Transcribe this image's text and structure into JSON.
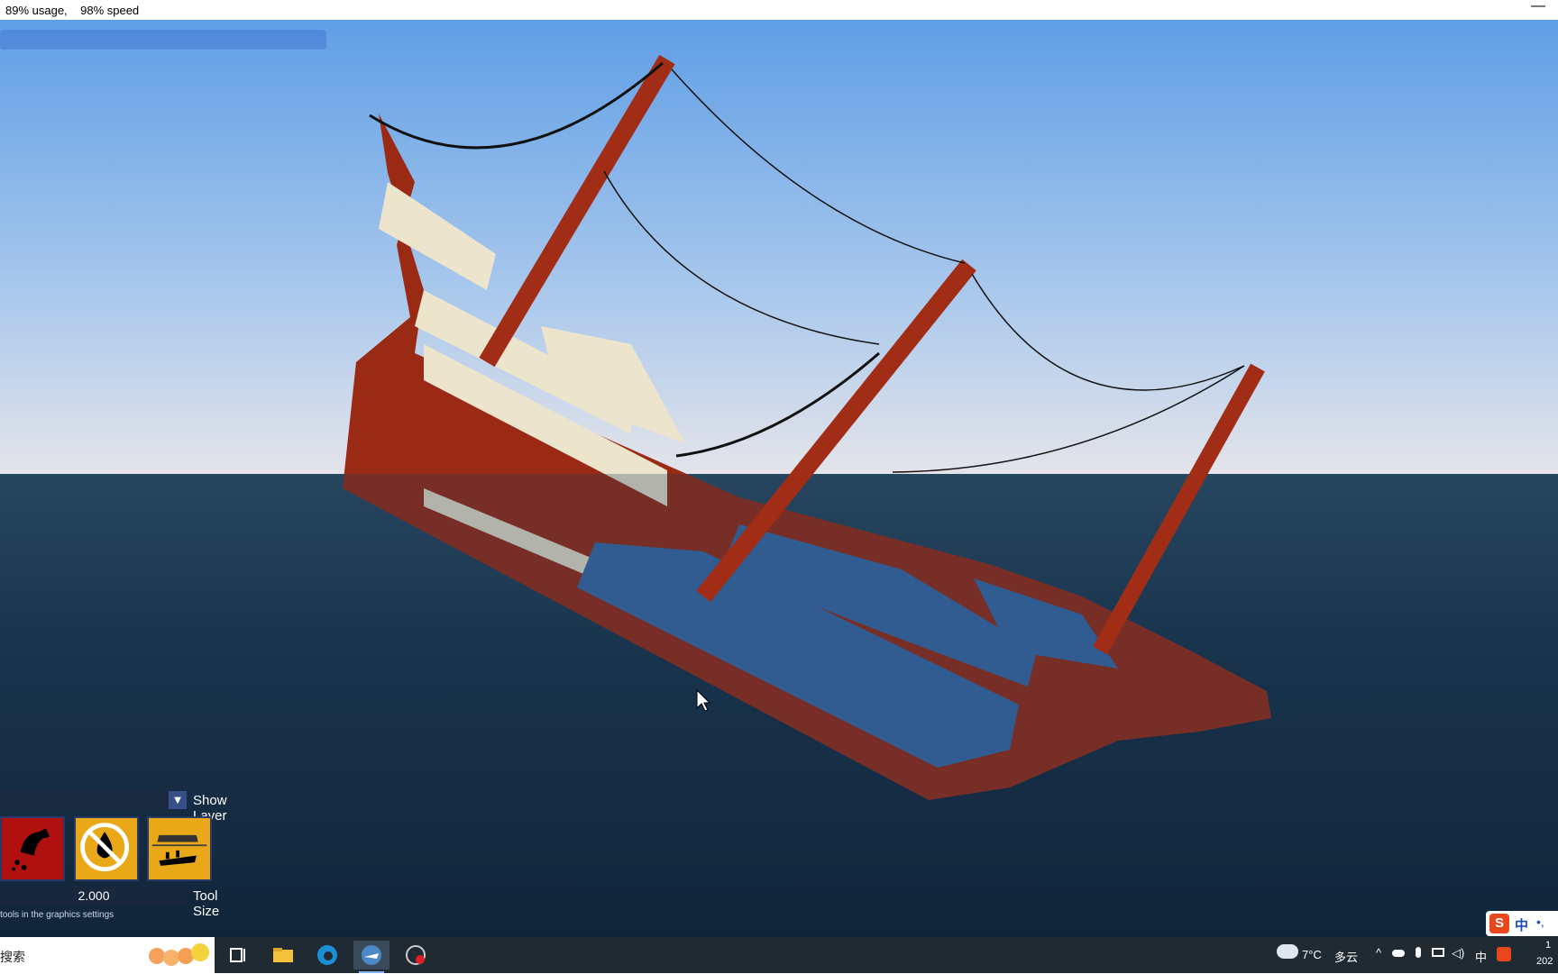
{
  "titlebar": {
    "status": "89% usage,    98% speed",
    "minimize_icon": "minimize-icon"
  },
  "hud": {
    "layer_dropdown_value": "",
    "show_layer_label": "Show Layer",
    "tools": [
      {
        "name": "flood-tool",
        "icon": "water-faucet-icon",
        "color": "#b01010"
      },
      {
        "name": "drain-tool",
        "icon": "no-water-icon",
        "color": "#e8a817"
      },
      {
        "name": "sink-tool",
        "icon": "sinking-ship-icon",
        "color": "#e8a817"
      }
    ],
    "tool_size_value": "2.000",
    "tool_size_label": "Tool Size",
    "hint": "tools in the graphics settings"
  },
  "taskbar": {
    "search_text": "搜索",
    "weather_temp": "7°C",
    "weather_desc": "多云",
    "ime_mode": "中",
    "clock_time": "1",
    "clock_date": "202"
  },
  "ime_bar": {
    "label": "中",
    "punct": "•,"
  },
  "colors": {
    "sky_top": "#5f9ee6",
    "sky_horizon": "#e4e4ea",
    "sea_top": "#2c4b63",
    "sea_bottom": "#0d1e30",
    "hull": "#9a2a14",
    "deck": "#ece4cc",
    "flooded": "#3a6aa8"
  }
}
